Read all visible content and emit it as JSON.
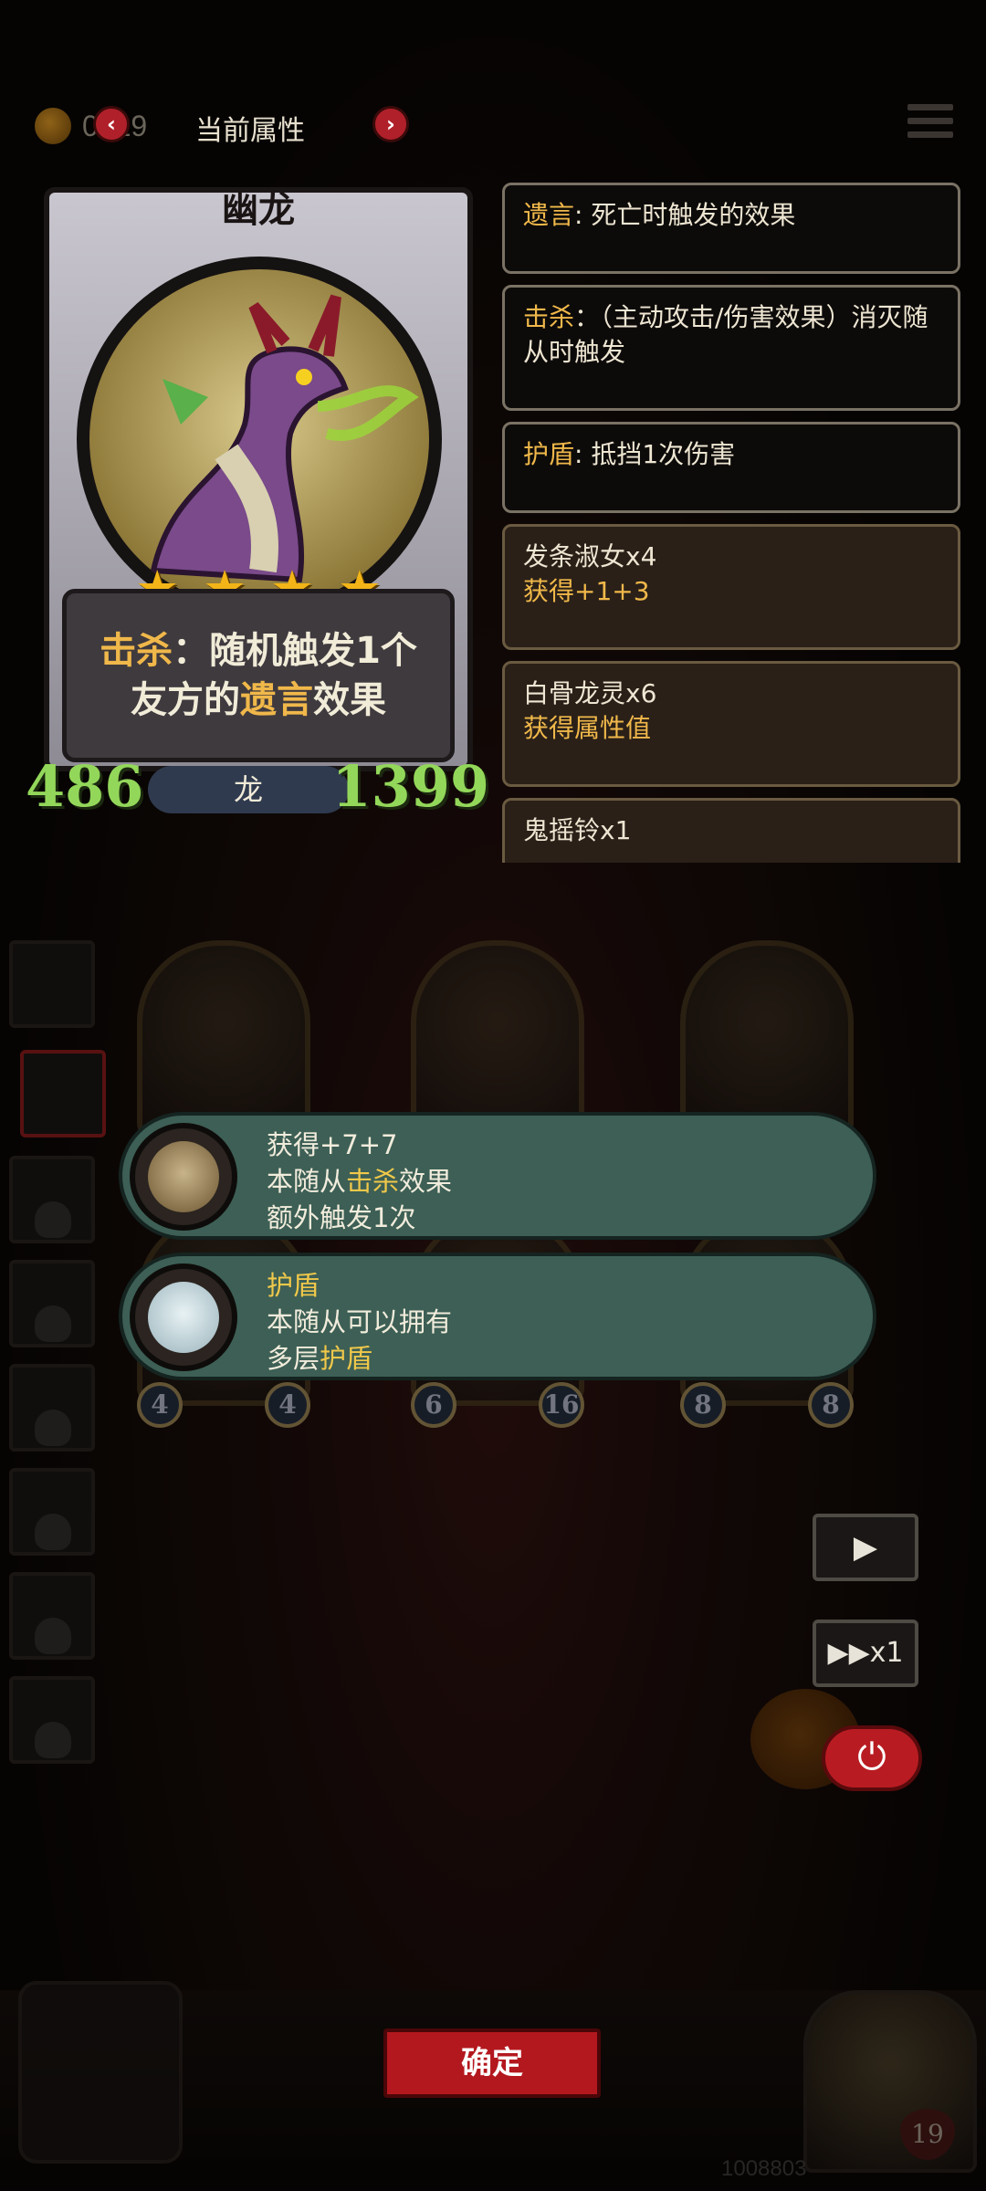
{
  "topbar": {
    "coin_text": "0019",
    "title": "当前属性"
  },
  "card": {
    "name": "幽龙",
    "stars": 4,
    "desc_line1_key": "击杀",
    "desc_line1_rest": "：随机触发1个",
    "desc_line2_pre": "友方的",
    "desc_line2_key": "遗言",
    "desc_line2_post": "效果",
    "attack": "486",
    "health": "1399",
    "tribe": "龙"
  },
  "keywords": [
    {
      "key": "遗言",
      "text": ": 死亡时触发的效果"
    },
    {
      "key": "击杀",
      "text": "：（主动攻击/伤害效果）消灭随从时触发"
    },
    {
      "key": "护盾",
      "text": ": 抵挡1次伤害"
    }
  ],
  "items": [
    {
      "name": "发条淑女x4",
      "sub": "获得+1+3"
    },
    {
      "name": "白骨龙灵x6",
      "sub": "获得属性值"
    },
    {
      "name": "鬼摇铃x1",
      "sub": ""
    }
  ],
  "effects": [
    {
      "line1": "获得+7+7",
      "line2_pre": "本随从",
      "line2_key": "击杀",
      "line2_post": "效果",
      "line3": "额外触发1次"
    },
    {
      "line1_key": "护盾",
      "line2": "本随从可以拥有",
      "line3_pre": "多层",
      "line3_key": "护盾"
    }
  ],
  "board_stats": [
    {
      "atk": "4",
      "hp": "4"
    },
    {
      "atk": "6",
      "hp": "16"
    },
    {
      "atk": "8",
      "hp": "8"
    }
  ],
  "controls": {
    "play": "▶",
    "speed": "▶▶x1",
    "power": "⏻"
  },
  "confirm_label": "确定",
  "hero_health": "19",
  "bottom_right_text": "1008803",
  "colors": {
    "accent_gold": "#f0b84a",
    "stat_green": "#93d75a",
    "effect_teal": "#3d5f55",
    "confirm_red": "#b3181e"
  }
}
